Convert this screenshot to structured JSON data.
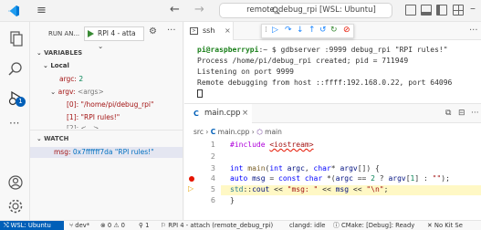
{
  "titlebar": {
    "search_text": "remote_debug_rpi [WSL: Ubuntu]"
  },
  "sidebar": {
    "title": "RUN AN...",
    "config_select": "RPI 4 - atta",
    "variables_header": "VARIABLES",
    "local_header": "Local",
    "argc_name": "argc:",
    "argc_value": "2",
    "argv_name": "argv:",
    "argv_type": "<args>",
    "argv0_name": "[0]:",
    "argv0_value": "\"/home/pi/debug_rpi\"",
    "argv1_name": "[1]:",
    "argv1_value": "\"RPI rules!\"",
    "argv2_partial": "[2]: <...>",
    "watch_header": "WATCH",
    "watch_name": "msg:",
    "watch_value": "0x7ffffff7da \"RPI rules!\""
  },
  "terminal": {
    "tab_label": "ssh",
    "prompt_user": "pi@raspberrypi",
    "prompt_rest": ":~ $ gdbserver :9999 debug_rpi \"RPI rules!\"",
    "line2": "Process /home/pi/debug_rpi created; pid = 711949",
    "line3": "Listening on port 9999",
    "line4": "Remote debugging from host ::ffff:192.168.0.22, port 64096"
  },
  "editor": {
    "tab_label": "main.cpp",
    "crumb_src": "src",
    "crumb_file": "main.cpp",
    "crumb_fn": "main",
    "lines": [
      {
        "n": "1",
        "text": "#include <iostream>"
      },
      {
        "n": "2",
        "text": ""
      },
      {
        "n": "3",
        "text": "int main(int argc, char* argv[]) {"
      },
      {
        "n": "4",
        "text": "  auto msg = const char *(argc == 2 ? argv[1] : \"\");"
      },
      {
        "n": "5",
        "text": "  std::cout << \"msg: \" << msg << \"\\n\";"
      },
      {
        "n": "6",
        "text": "}"
      }
    ]
  },
  "statusbar": {
    "remote": "WSL: Ubuntu",
    "branch": "dev*",
    "problems": "0 ⚠ 0",
    "ports": "1",
    "launch": "RPI 4 - attach (remote_debug_rpi)",
    "clangd": "clangd: idle",
    "cmake": "CMake: [Debug]: Ready",
    "kit": "No Kit Se"
  },
  "colors": {
    "accent": "#005fb8",
    "breakpoint": "#e51400",
    "current_line": "#fff8c5",
    "prompt_green": "#1a7f1a"
  }
}
